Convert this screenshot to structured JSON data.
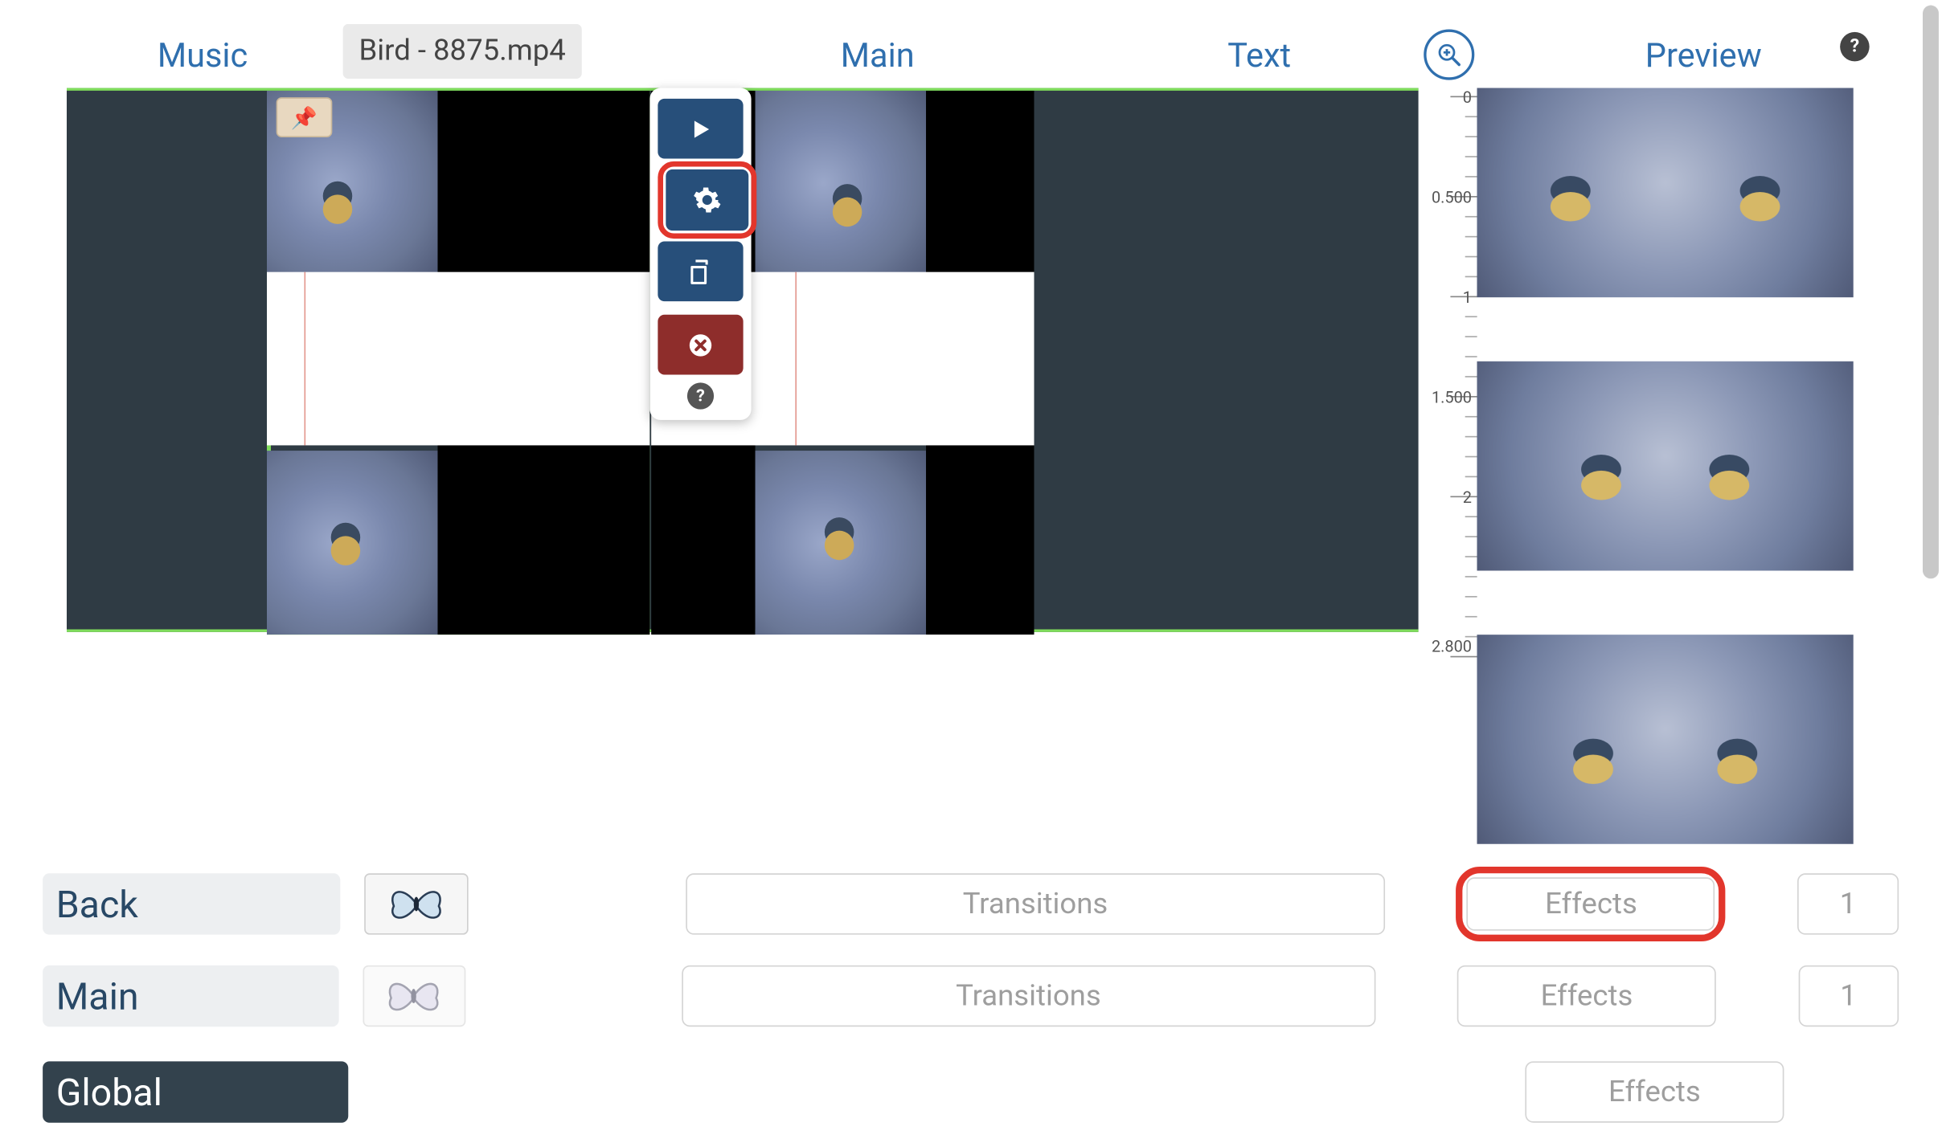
{
  "tabs": {
    "music": "Music",
    "main": "Main",
    "text": "Text",
    "preview": "Preview"
  },
  "clip": {
    "filename": "Bird - 8875.mp4"
  },
  "ruler": {
    "t0": "0",
    "t1": "0.500",
    "t2": "1",
    "t3": "1.500",
    "t4": "2",
    "t5": "2.800"
  },
  "rows": {
    "back": "Back",
    "main": "Main",
    "global": "Global"
  },
  "buttons": {
    "transitions": "Transitions",
    "effects": "Effects",
    "count1": "1",
    "count2": "1"
  },
  "icons": {
    "zoom": "zoom-in-icon",
    "help": "?",
    "pin": "📌",
    "play": "play-icon",
    "gear": "gear-icon",
    "copy": "copy-icon",
    "delete": "delete-icon"
  }
}
